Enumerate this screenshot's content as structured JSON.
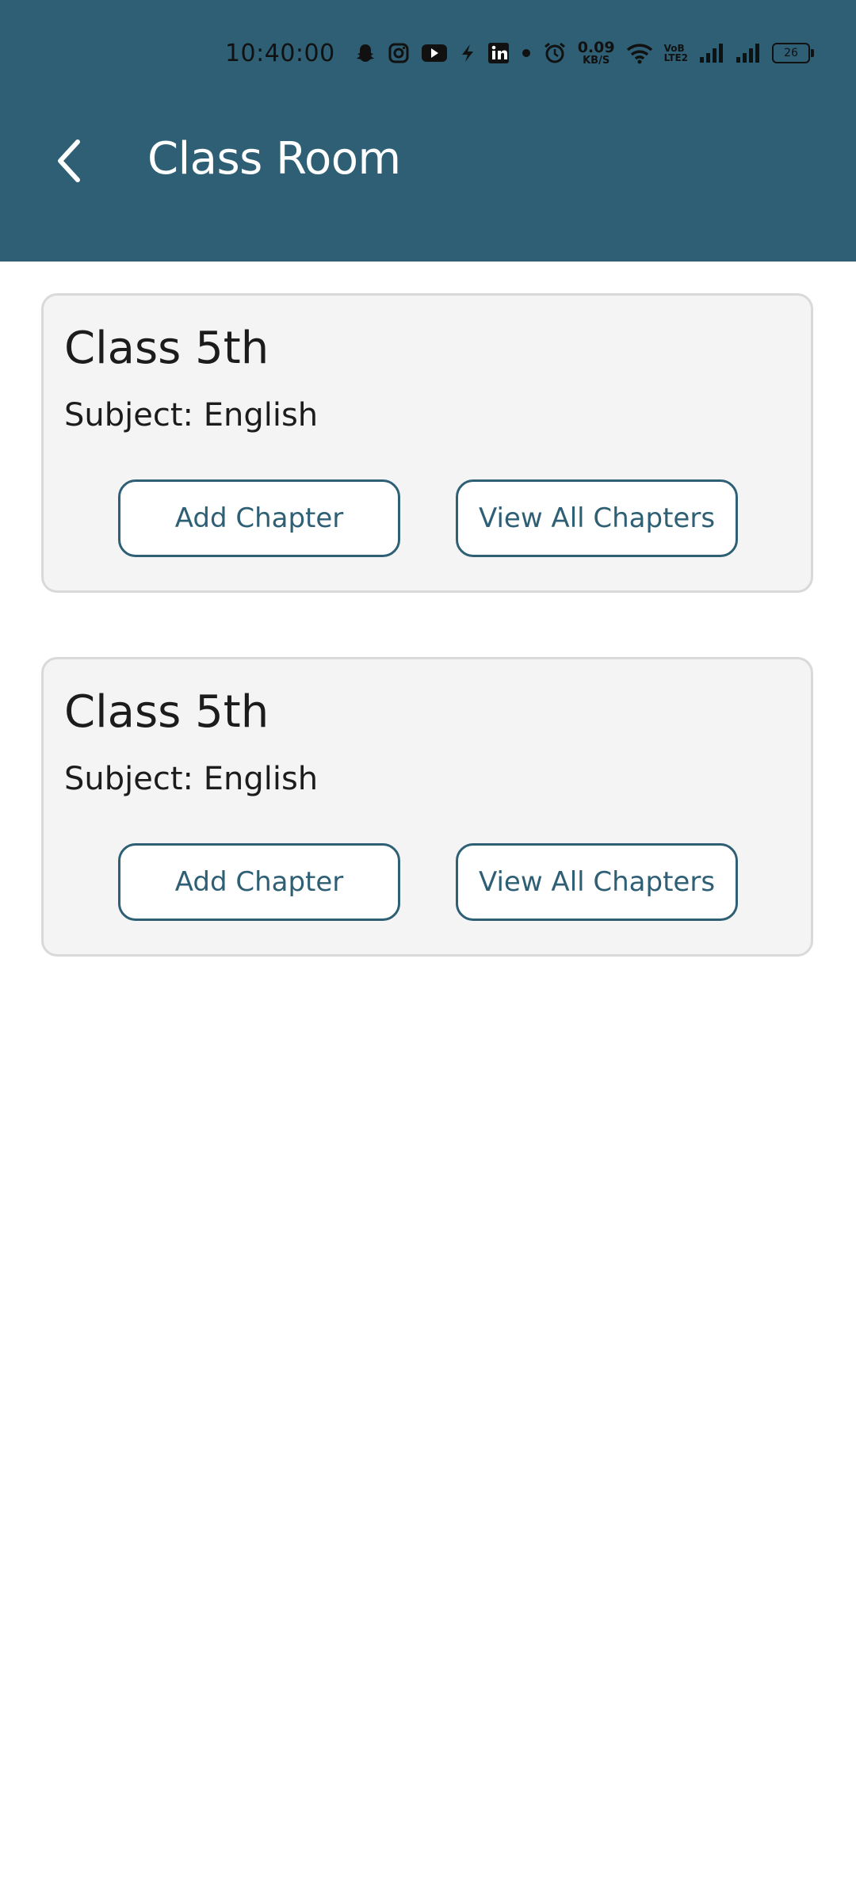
{
  "status_bar": {
    "time": "10:40:00",
    "icons": [
      "snapchat-icon",
      "instagram-icon",
      "youtube-icon",
      "lightning-icon",
      "linkedin-icon",
      "dot-icon",
      "alarm-icon",
      "wifi-icon",
      "signal-icon",
      "signal-icon",
      "battery-icon"
    ],
    "net_speed_value": "0.09",
    "net_speed_unit": "KB/S",
    "volte_top": "VoB",
    "volte_bottom": "LTE2",
    "battery_level": "26"
  },
  "app_bar": {
    "title": "Class Room",
    "back_icon": "chevron-left-icon",
    "background_color": "#2e5f74"
  },
  "classes": [
    {
      "title": "Class 5th",
      "subject": "Subject: English",
      "add_button": "Add Chapter",
      "view_button": "View All Chapters"
    },
    {
      "title": "Class 5th",
      "subject": "Subject: English",
      "add_button": "Add Chapter",
      "view_button": "View All Chapters"
    }
  ],
  "colors": {
    "accent": "#2e5f74",
    "card_background": "#f4f4f4",
    "card_border": "#d9d9d9"
  }
}
